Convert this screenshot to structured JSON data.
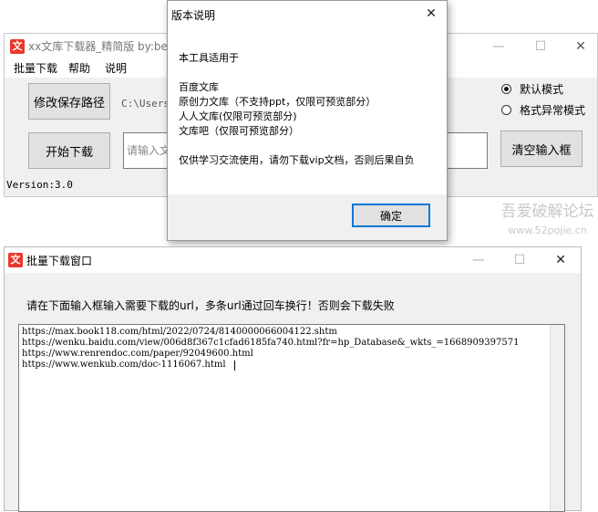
{
  "main_window": {
    "title": "xx文库下载器_精简版  by:be",
    "menu": [
      "批量下载",
      "帮助",
      "说明"
    ],
    "buttons": {
      "change_path": "修改保存路径",
      "start_download": "开始下载",
      "clear_input": "清空输入框"
    },
    "path_value": "C:\\Users",
    "input_placeholder": "请输入文",
    "radios": [
      {
        "label": "默认模式",
        "checked": true
      },
      {
        "label": "格式异常模式",
        "checked": false
      }
    ],
    "version": "Version:3.0"
  },
  "about_dialog": {
    "title": "版本说明",
    "lines": [
      "本工具适用于",
      "百度文库",
      "原创力文库（不支持ppt，仅限可预览部分）",
      "人人文库(仅限可预览部分)",
      "文库吧（仅限可预览部分）",
      "仅供学习交流使用，请勿下载vip文档，否则后果自负"
    ],
    "ok_button": "确定"
  },
  "batch_window": {
    "title": "批量下载窗口",
    "instruction": "请在下面输入框输入需要下载的url，多条url通过回车换行！否则会下载失败",
    "urls": [
      "https://max.book118.com/html/2022/0724/8140000066004122.shtm",
      "https://wenku.baidu.com/view/006d8f367c1cfad6185fa740.html?fr=hp_Database&_wkts_=1668909397571",
      "https://www.renrendoc.com/paper/92049600.html",
      "https://www.wenkub.com/doc-1116067.html"
    ]
  },
  "watermark": {
    "line1": "吾爱破解论坛",
    "line2": "www.52pojie.cn"
  },
  "icons": {
    "app": "文",
    "close": "✕",
    "minimize": "—",
    "maximize": "☐"
  }
}
